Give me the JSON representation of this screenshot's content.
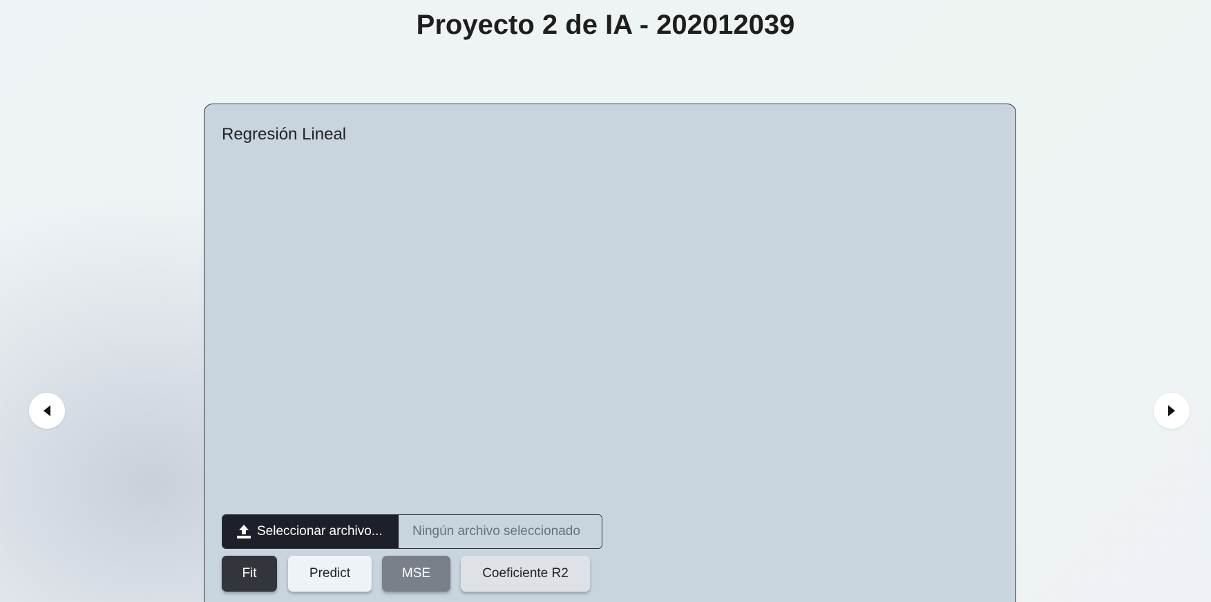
{
  "header": {
    "title": "Proyecto 2 de IA - 202012039"
  },
  "card": {
    "title": "Regresión Lineal",
    "file_input": {
      "button_label": "Seleccionar archivo...",
      "placeholder": "Ningún archivo seleccionado",
      "icon": "upload-icon"
    },
    "buttons": [
      {
        "label": "Fit",
        "color": "#32353b"
      },
      {
        "label": "Predict",
        "color": "#eef3f7"
      },
      {
        "label": "MSE",
        "color": "#79808a"
      },
      {
        "label": "Coeficiente R2",
        "color": "#dee2e6"
      }
    ]
  },
  "carousel": {
    "prev_icon": "chevron-left-icon",
    "next_icon": "chevron-right-icon"
  }
}
